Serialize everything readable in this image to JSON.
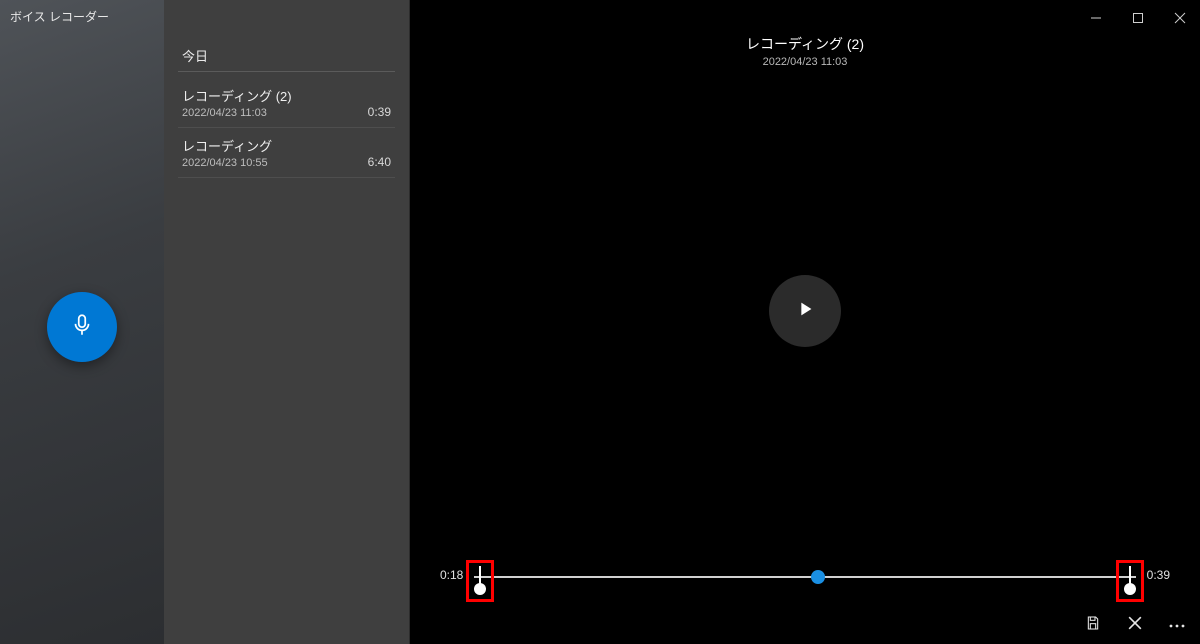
{
  "app": {
    "title": "ボイス レコーダー"
  },
  "window_controls": {
    "minimize": "minimize",
    "maximize": "maximize",
    "close": "close"
  },
  "list": {
    "heading": "今日",
    "items": [
      {
        "title": "レコーディング (2)",
        "subtitle": "2022/04/23 11:03",
        "duration": "0:39"
      },
      {
        "title": "レコーディング",
        "subtitle": "2022/04/23 10:55",
        "duration": "6:40"
      }
    ]
  },
  "current": {
    "title": "レコーディング (2)",
    "subtitle": "2022/04/23 11:03"
  },
  "transport": {
    "trim_start_label": "0:18",
    "trim_end_label": "0:39",
    "playhead_percent": 52
  },
  "actions": {
    "save": "save",
    "cancel": "cancel",
    "more": "more"
  },
  "colors": {
    "accent": "#0078d4",
    "playhead": "#1a8fe3",
    "highlight_box": "#ff0000"
  }
}
